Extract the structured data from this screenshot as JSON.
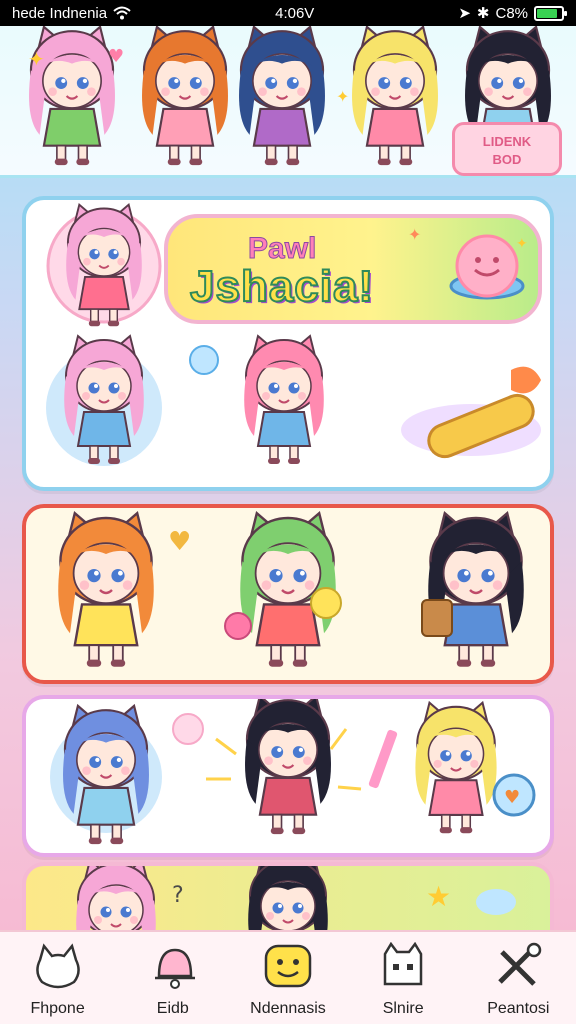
{
  "status_bar": {
    "carrier": "hede Indnenia",
    "time": "4:06V",
    "battery_text": "C8%"
  },
  "header": {
    "badge_line1": "LIDENK",
    "badge_line2": "BOD",
    "characters": [
      {
        "hair": "#f6a7d6",
        "outfit": "#7fce6a"
      },
      {
        "hair": "#e7782f",
        "outfit": "#ff9fb6"
      },
      {
        "hair": "#2f4f8f",
        "outfit": "#b06ac8"
      },
      {
        "hair": "#f7e36a",
        "outfit": "#ff8aa8"
      },
      {
        "hair": "#222233",
        "outfit": "#8fd1ee"
      }
    ]
  },
  "banner": {
    "title_top": "Pawl",
    "title_main": "Jshacia!"
  },
  "cards": {
    "card1_chars": [
      {
        "hair": "#f6a7d6",
        "outfit": "#ff6f8f"
      },
      {
        "hair": "#f6a7d6",
        "outfit": "#6fb6e8"
      },
      {
        "hair": "#ff8ab0",
        "outfit": "#6fb6e8"
      }
    ],
    "card2_chars": [
      {
        "hair": "#f28a3a",
        "outfit": "#ffe35a"
      },
      {
        "hair": "#7fcf6f",
        "outfit": "#ff6f6f"
      },
      {
        "hair": "#222233",
        "outfit": "#5b8fd8"
      }
    ],
    "card3_chars": [
      {
        "hair": "#6f8fe0",
        "outfit": "#8fd1ee"
      },
      {
        "hair": "#222233",
        "outfit": "#e0566f"
      },
      {
        "hair": "#f7e36a",
        "outfit": "#ff8aa8"
      }
    ],
    "card4_chars": [
      {
        "hair": "#f6a7d6",
        "outfit": "#ff8aa8"
      },
      {
        "hair": "#222233",
        "outfit": "#6fb6e8"
      }
    ]
  },
  "nav": {
    "items": [
      {
        "label": "Fhpone",
        "icon": "cat-head-icon"
      },
      {
        "label": "Eidb",
        "icon": "bell-icon"
      },
      {
        "label": "Ndennasis",
        "icon": "smiley-icon"
      },
      {
        "label": "Slnire",
        "icon": "cat-face-icon"
      },
      {
        "label": "Peantosi",
        "icon": "tools-icon"
      }
    ]
  },
  "colors": {
    "accent_pink": "#f48aac",
    "card1_border": "#8fd1ee",
    "card2_border": "#e8584a",
    "card3_border": "#e7a8e8"
  }
}
